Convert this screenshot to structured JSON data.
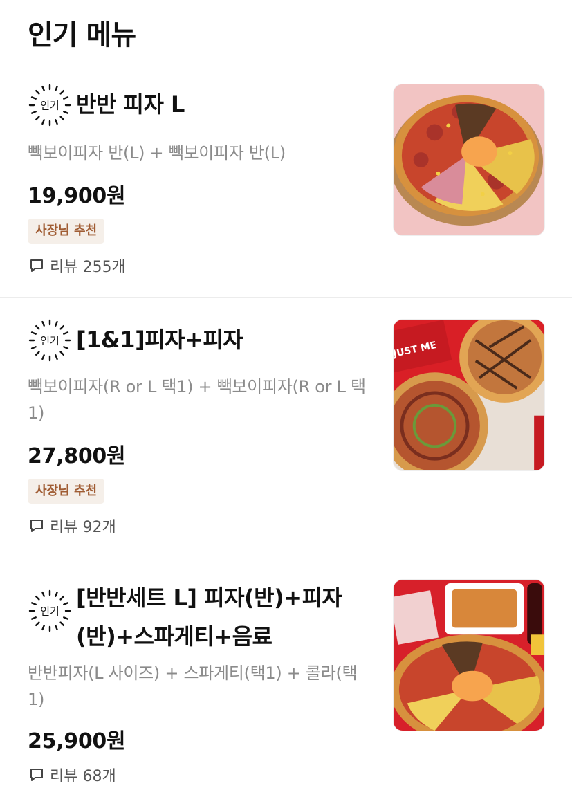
{
  "header": {
    "title": "인기 메뉴"
  },
  "badge_label": "인기",
  "items": [
    {
      "name": "반반 피자 L",
      "description": "빽보이피자 반(L) + 빽보이피자 반(L)",
      "price": "19,900원",
      "tag": "사장님 추천",
      "reviews": "리뷰 255개"
    },
    {
      "name": "[1&1]피자+피자",
      "description": "빽보이피자(R or L 택1) + 빽보이피자(R or L 택1)",
      "price": "27,800원",
      "tag": "사장님 추천",
      "reviews": "리뷰 92개"
    },
    {
      "name": "[반반세트 L] 피자(반)+피자(반)+스파게티+음료",
      "description": "반반피자(L 사이즈) + 스파게티(택1) + 콜라(택1)",
      "price": "25,900원",
      "reviews": "리뷰 68개"
    }
  ],
  "thumb_text": "JUST ME",
  "colors": {
    "tag_bg": "#f5efe9",
    "tag_text": "#a05c33",
    "muted": "#8b8b8b"
  }
}
